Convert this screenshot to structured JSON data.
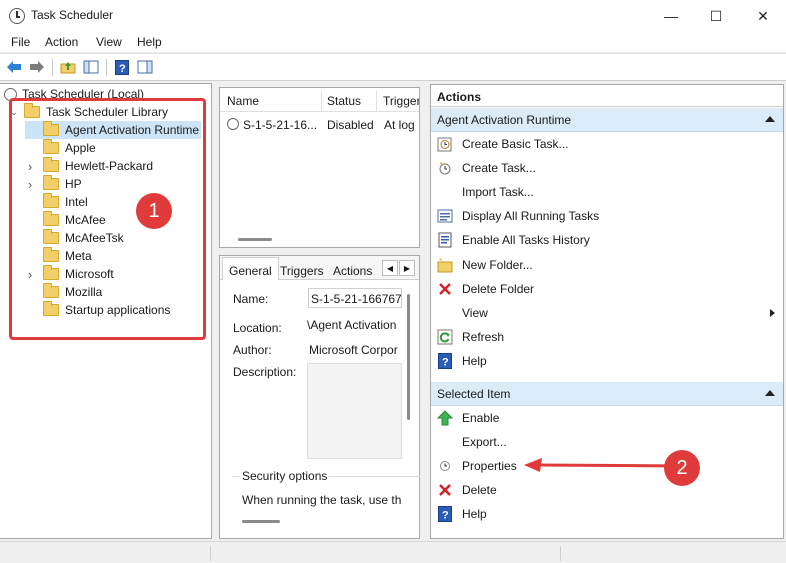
{
  "window": {
    "title": "Task Scheduler",
    "minimize": "—",
    "maximize": "☐",
    "close": "✕"
  },
  "menu": [
    "File",
    "Action",
    "View",
    "Help"
  ],
  "toolbar_icons": [
    "back-icon",
    "forward-icon",
    "up-folder-icon",
    "show-hide-console-tree-icon",
    "help-icon",
    "show-action-pane-icon"
  ],
  "tree": {
    "root": "Task Scheduler (Local)",
    "library": "Task Scheduler Library",
    "items": [
      {
        "label": "Agent Activation Runtime",
        "expandable": false,
        "selected": true
      },
      {
        "label": "Apple",
        "expandable": false
      },
      {
        "label": "Hewlett-Packard",
        "expandable": true
      },
      {
        "label": "HP",
        "expandable": true
      },
      {
        "label": "Intel",
        "expandable": false
      },
      {
        "label": "McAfee",
        "expandable": false
      },
      {
        "label": "McAfeeTsk",
        "expandable": false
      },
      {
        "label": "Meta",
        "expandable": false
      },
      {
        "label": "Microsoft",
        "expandable": true
      },
      {
        "label": "Mozilla",
        "expandable": false
      },
      {
        "label": "Startup applications",
        "expandable": false
      }
    ]
  },
  "task_list": {
    "columns": [
      "Name",
      "Status",
      "Trigger"
    ],
    "rows": [
      {
        "name": "S-1-5-21-16...",
        "status": "Disabled",
        "trigger": "At log"
      }
    ]
  },
  "details": {
    "tabs": [
      "General",
      "Triggers",
      "Actions"
    ],
    "active_tab": "General",
    "name_label": "Name:",
    "name_value": "S-1-5-21-1667670",
    "location_label": "Location:",
    "location_value": "\\Agent Activation",
    "author_label": "Author:",
    "author_value": "Microsoft Corpor",
    "description_label": "Description:",
    "security_title": "Security options",
    "security_text": "When running the task, use th"
  },
  "actions": {
    "header": "Actions",
    "section1": "Agent Activation Runtime",
    "items1": [
      {
        "label": "Create Basic Task...",
        "icon": "create-basic-task-icon"
      },
      {
        "label": "Create Task...",
        "icon": "create-task-icon"
      },
      {
        "label": "Import Task...",
        "icon": "none"
      },
      {
        "label": "Display All Running Tasks",
        "icon": "running-tasks-icon"
      },
      {
        "label": "Enable All Tasks History",
        "icon": "history-icon"
      },
      {
        "label": "New Folder...",
        "icon": "new-folder-icon"
      },
      {
        "label": "Delete Folder",
        "icon": "delete-x-icon"
      },
      {
        "label": "View",
        "icon": "none",
        "submenu": true
      },
      {
        "label": "Refresh",
        "icon": "refresh-icon"
      },
      {
        "label": "Help",
        "icon": "help-icon"
      }
    ],
    "section2": "Selected Item",
    "items2": [
      {
        "label": "Enable",
        "icon": "enable-arrow-icon"
      },
      {
        "label": "Export...",
        "icon": "none"
      },
      {
        "label": "Properties",
        "icon": "properties-icon"
      },
      {
        "label": "Delete",
        "icon": "delete-x-icon"
      },
      {
        "label": "Help",
        "icon": "help-icon"
      }
    ]
  },
  "annotations": {
    "badge1": "1",
    "badge2": "2",
    "color": "#e03b3b"
  }
}
